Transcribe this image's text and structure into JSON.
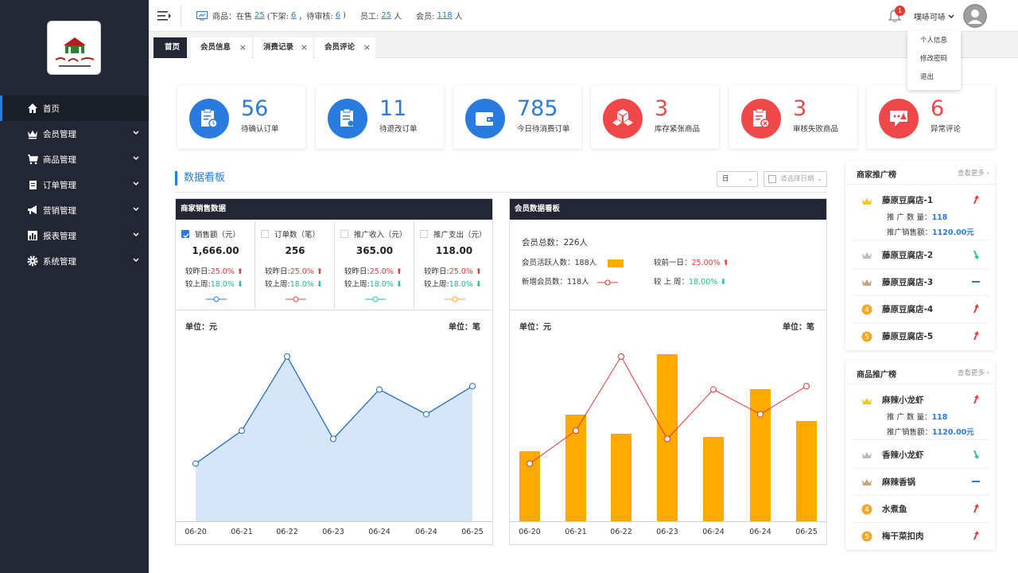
{
  "sidebar": {
    "items": [
      {
        "label": "首页",
        "icon": "home-icon"
      },
      {
        "label": "会员管理",
        "icon": "crown-icon"
      },
      {
        "label": "商品管理",
        "icon": "cart-icon"
      },
      {
        "label": "订单管理",
        "icon": "clipboard-icon"
      },
      {
        "label": "营销管理",
        "icon": "megaphone-icon"
      },
      {
        "label": "报表管理",
        "icon": "bar-chart-icon"
      },
      {
        "label": "系统管理",
        "icon": "gear-icon"
      }
    ]
  },
  "topbar": {
    "goods_label": "商品：在售",
    "goods_on_sale": "25",
    "off_shelf_label": "(下架:",
    "off_shelf": "6",
    "pending_label": "，待审核:",
    "pending": "6",
    "close_paren": ")",
    "staff_label": "员工:",
    "staff": "25",
    "staff_unit": "人",
    "member_label": "会员:",
    "members": "118",
    "member_unit": "人",
    "notifications": "1",
    "username": "噗哧可哧"
  },
  "user_menu": [
    "个人信息",
    "修改密码",
    "退出"
  ],
  "tabs": [
    {
      "label": "首页"
    },
    {
      "label": "会员信息"
    },
    {
      "label": "消费记录"
    },
    {
      "label": "会员评论"
    }
  ],
  "stat_cards": [
    {
      "value": "56",
      "label": "待确认订单",
      "color": "#2a7be0",
      "icon": "clipboard-clock-icon"
    },
    {
      "value": "11",
      "label": "待退改订单",
      "color": "#2a7be0",
      "icon": "clipboard-refund-icon"
    },
    {
      "value": "785",
      "label": "今日待消费订单",
      "color": "#2a7be0",
      "icon": "wallet-icon"
    },
    {
      "value": "3",
      "label": "库存紧张商品",
      "color": "#f04848",
      "icon": "boxes-icon"
    },
    {
      "value": "3",
      "label": "审核失败商品",
      "color": "#f04848",
      "icon": "clipboard-fail-icon"
    },
    {
      "value": "6",
      "label": "异常评论",
      "color": "#f04848",
      "icon": "comment-alert-icon"
    }
  ],
  "dashboard": {
    "title": "数据看板",
    "period": "日",
    "date_placeholder": "请选择日期"
  },
  "sales_panel": {
    "title": "商家销售数据",
    "kpis": [
      {
        "label": "销售额（元）",
        "value": "1,666.00",
        "checked": true,
        "day_label": "较昨日:",
        "day": "25.0%",
        "week_label": "较上周:",
        "week": "18.0%",
        "color": "#2a7be0"
      },
      {
        "label": "订单数（笔）",
        "value": "256",
        "checked": false,
        "day_label": "较昨日:",
        "day": "25.0%",
        "week_label": "较上周:",
        "week": "18.0%",
        "color": "#f04848"
      },
      {
        "label": "推广收入（元）",
        "value": "365.00",
        "checked": false,
        "day_label": "较昨日:",
        "day": "25.0%",
        "week_label": "较上周:",
        "week": "18.0%",
        "color": "#1bbc9b"
      },
      {
        "label": "推广支出（元）",
        "value": "118.00",
        "checked": false,
        "day_label": "较昨日:",
        "day": "25.0%",
        "week_label": "较上周:",
        "week": "18.0%",
        "color": "#f5a623"
      }
    ],
    "unit_left": "单位：元",
    "unit_right": "单位：笔"
  },
  "member_panel": {
    "title": "会员数据看板",
    "total": "会员总数：226人",
    "active_label": "会员活跃人数：188人",
    "new_label": "新增会员数：118人",
    "prev_day_label": "较前一日：",
    "prev_day": "25.00%",
    "prev_week_label": "较 上 周：",
    "prev_week": "18.00%",
    "unit_left": "单位：元",
    "unit_right": "单位：笔"
  },
  "chart_data": [
    {
      "type": "area",
      "x": [
        "06-20",
        "06-21",
        "06-22",
        "06-23",
        "06-24",
        "06-24",
        "06-25"
      ],
      "series": [
        {
          "values": [
            35,
            55,
            100,
            50,
            80,
            65,
            82
          ]
        }
      ],
      "color": "#1f6fc5",
      "fill": "#d6e6f8",
      "ylim": [
        0,
        100
      ]
    },
    {
      "type": "bar",
      "x": [
        "06-20",
        "06-21",
        "06-22",
        "06-23",
        "06-24",
        "06-24",
        "06-25"
      ],
      "series": [
        {
          "values": [
            44,
            67,
            55,
            105,
            53,
            83,
            63
          ],
          "kind": "bar",
          "color": "#ffaa00"
        },
        {
          "values": [
            35,
            55,
            100,
            50,
            80,
            65,
            82
          ],
          "kind": "line",
          "color": "#e53935"
        }
      ],
      "ylim": [
        0,
        105
      ]
    }
  ],
  "merchant_rank": {
    "title": "商家推广榜",
    "more": "查看更多",
    "items": [
      {
        "name": "藤原豆腐店-1",
        "qty_label": "推 广 数 量：",
        "qty": "118",
        "amt_label": "推广销售额：",
        "amt": "1120.00元",
        "trend": "up"
      },
      {
        "name": "藤原豆腐店-2",
        "trend": "down"
      },
      {
        "name": "藤原豆腐店-3",
        "trend": "flat"
      },
      {
        "name": "藤原豆腐店-4",
        "rank": "4",
        "trend": "up"
      },
      {
        "name": "藤原豆腐店-5",
        "rank": "5",
        "trend": "up"
      }
    ]
  },
  "product_rank": {
    "title": "商品推广榜",
    "more": "查看更多",
    "items": [
      {
        "name": "麻辣小龙虾",
        "qty_label": "推 广 数 量：",
        "qty": "118",
        "amt_label": "推广销售额：",
        "amt": "1120.00元",
        "trend": "up"
      },
      {
        "name": "香辣小龙虾",
        "trend": "down"
      },
      {
        "name": "麻辣香锅",
        "trend": "flat"
      },
      {
        "name": "水煮鱼",
        "rank": "4",
        "trend": "up"
      },
      {
        "name": "梅干菜扣肉",
        "rank": "5",
        "trend": "up"
      }
    ]
  }
}
